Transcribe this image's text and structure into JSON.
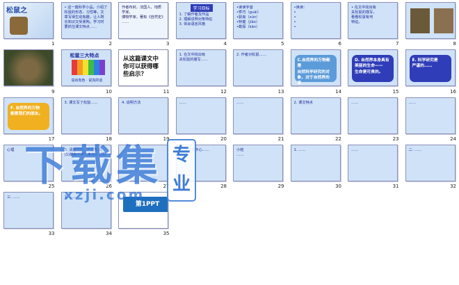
{
  "slides": [
    {
      "n": "1",
      "kind": "title",
      "title": "松鼠之",
      "lines": []
    },
    {
      "n": "2",
      "kind": "text",
      "bg": "#cfe2f7",
      "color": "#1d2a9a",
      "lines": [
        "• 这一篇科学小品，介绍了",
        "松鼠的形态、习性等，文",
        "章写得生动有趣，让人既",
        "长知识又受熏陶。学习时",
        "要抓住课文特点……"
      ]
    },
    {
      "n": "3",
      "kind": "text",
      "bg": "#eef4fb",
      "color": "#222266",
      "lines": [
        "作者布封，法国人，地质学家、",
        "博物学家，著有《自然史》",
        "……"
      ]
    },
    {
      "n": "4",
      "kind": "goal",
      "bg": "#cfe2f7",
      "color": "#1d2a9a",
      "header": "学习目标",
      "lines": [
        "1. 了解作者及作品",
        "2. 理解说明对象特征",
        "3. 体会语言风格"
      ]
    },
    {
      "n": "5",
      "kind": "text",
      "bg": "#cfe2f7",
      "color": "#1d2a9a",
      "lines": [
        "•读读字音",
        "•乖巧（guāi）",
        "•驯良（xùn）",
        "•矫健（jiǎo）",
        "•勘探（kān）"
      ]
    },
    {
      "n": "6",
      "kind": "text",
      "bg": "#cfe2f7",
      "color": "#1d2a9a",
      "lines": [
        "•读读：",
        "•",
        "•",
        "•",
        "•"
      ]
    },
    {
      "n": "7",
      "kind": "text",
      "bg": "#cfe2f7",
      "color": "#1d2a9a",
      "lines": [
        "• 在文中找出有",
        "关松鼠的描写，",
        "看看松鼠有何",
        "特征。"
      ]
    },
    {
      "n": "8",
      "kind": "photo2",
      "bg": "#cfe2f7",
      "lines": []
    },
    {
      "n": "9",
      "kind": "photo",
      "bg": "#6a5a3a",
      "lines": []
    },
    {
      "n": "10",
      "kind": "stripes",
      "bg": "#cfe2f7",
      "header": "松鼠三大特点",
      "footer": "说出有色 · 说完的话",
      "lines": []
    },
    {
      "n": "11",
      "kind": "big",
      "bg": "#ffffff",
      "color": "#111111",
      "lines": [
        "从这篇课文中",
        "你可以获得哪",
        "些启示？"
      ]
    },
    {
      "n": "12",
      "kind": "text",
      "bg": "#cfe2f7",
      "color": "#1d2a9a",
      "lines": [
        "1. 在文中找出有",
        "关松鼠的描写……"
      ]
    },
    {
      "n": "13",
      "kind": "text",
      "bg": "#cfe2f7",
      "color": "#1d2a9a",
      "lines": [
        "2. 作者对松鼠……"
      ]
    },
    {
      "n": "14",
      "kind": "box",
      "bg": "#cfe2f7",
      "box": "#5c9bd9",
      "color": "#ffffff",
      "lines": [
        "C.自然界的万物都是",
        "自然科学研究的对",
        "象，对于自然界的事",
        "物，我们要持科学",
        "研究的态度。"
      ]
    },
    {
      "n": "15",
      "kind": "box",
      "bg": "#cfe2f7",
      "box": "#2f3db8",
      "color": "#ffffff",
      "lines": [
        "D. 自然界本身具有",
        "美丽的生命——",
        "生命是可贵的。"
      ]
    },
    {
      "n": "16",
      "kind": "box",
      "bg": "#cfe2f7",
      "box": "#2f3db8",
      "color": "#ffffff",
      "lines": [
        "E. 科学研究是",
        "严谨的……"
      ]
    },
    {
      "n": "17",
      "kind": "box",
      "bg": "#cfe2f7",
      "box": "#f0b020",
      "color": "#ffffff",
      "lines": [
        "F. 自然界的万物",
        "都是我们的朋友。"
      ]
    },
    {
      "n": "18",
      "kind": "text",
      "bg": "#cfe2f7",
      "color": "#1d2a9a",
      "lines": [
        "3. 课文写了松鼠……"
      ]
    },
    {
      "n": "19",
      "kind": "text",
      "bg": "#cfe2f7",
      "color": "#1d2a9a",
      "lines": [
        "4. 说明方法"
      ]
    },
    {
      "n": "20",
      "kind": "text",
      "bg": "#cfe2f7",
      "color": "#1d2a9a",
      "lines": [
        "……"
      ]
    },
    {
      "n": "21",
      "kind": "text",
      "bg": "#cfe2f7",
      "color": "#1d2a9a",
      "lines": [
        "……"
      ]
    },
    {
      "n": "22",
      "kind": "text",
      "bg": "#cfe2f7",
      "color": "#1d2a9a",
      "lines": [
        "2. 课文特点"
      ]
    },
    {
      "n": "23",
      "kind": "text",
      "bg": "#cfe2f7",
      "color": "#1d2a9a",
      "lines": [
        "……"
      ]
    },
    {
      "n": "24",
      "kind": "text",
      "bg": "#cfe2f7",
      "color": "#1d2a9a",
      "lines": [
        "……"
      ]
    },
    {
      "n": "25",
      "kind": "text",
      "bg": "#cfe2f7",
      "color": "#1d2a9a",
      "lines": [
        "心理"
      ]
    },
    {
      "n": "26",
      "kind": "text",
      "bg": "#cfe2f7",
      "color": "#1d2a9a",
      "lines": [
        "3. 清楚明白，可信度高",
        "(1)使用了修饰来加以说明"
      ]
    },
    {
      "n": "27",
      "kind": "text",
      "bg": "#cfe2f7",
      "color": "#1d2a9a",
      "lines": [
        "……"
      ]
    },
    {
      "n": "28",
      "kind": "text",
      "bg": "#cfe2f7",
      "color": "#1d2a9a",
      "lines": [
        "(5)本文在中心……"
      ]
    },
    {
      "n": "29",
      "kind": "text",
      "bg": "#cfe2f7",
      "color": "#1d2a9a",
      "lines": [
        "小结",
        "……"
      ]
    },
    {
      "n": "30",
      "kind": "text",
      "bg": "#cfe2f7",
      "color": "#1d2a9a",
      "lines": [
        "1. ……"
      ]
    },
    {
      "n": "31",
      "kind": "text",
      "bg": "#cfe2f7",
      "color": "#1d2a9a",
      "lines": [
        "……"
      ]
    },
    {
      "n": "32",
      "kind": "text",
      "bg": "#cfe2f7",
      "color": "#1d2a9a",
      "lines": [
        "二. ……"
      ]
    },
    {
      "n": "33",
      "kind": "text",
      "bg": "#cfe2f7",
      "color": "#1d2a9a",
      "lines": [
        "三. ……"
      ]
    },
    {
      "n": "34",
      "kind": "text",
      "bg": "#cfe2f7",
      "color": "#1d2a9a",
      "lines": [
        "1. ……"
      ]
    },
    {
      "n": "35",
      "kind": "logo",
      "bg": "#ffffff",
      "logo": "第1PPT",
      "lines": []
    }
  ],
  "watermark": {
    "main": "下载集",
    "sub": "xzji.com",
    "stamp": "专业"
  },
  "colors": {
    "slide_bg": "#cfe2f7",
    "text_blue": "#1d2a9a",
    "border": "#8a8fb8"
  }
}
